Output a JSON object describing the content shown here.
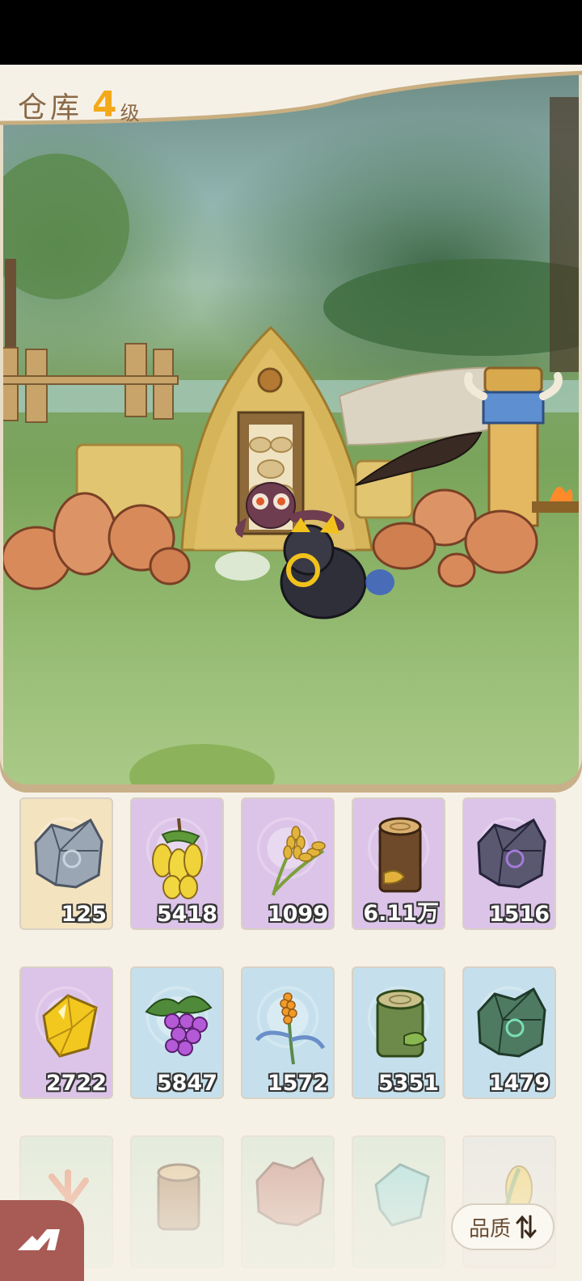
{
  "header": {
    "title": "仓库",
    "level": "4",
    "level_unit": "级"
  },
  "items": [
    {
      "name": "grey-stone",
      "count": "125",
      "quality": "gold"
    },
    {
      "name": "banana",
      "count": "5418",
      "quality": "purple"
    },
    {
      "name": "wheat",
      "count": "1099",
      "quality": "purple"
    },
    {
      "name": "wood-log",
      "count": "6.11万",
      "quality": "purple"
    },
    {
      "name": "dark-stone",
      "count": "1516",
      "quality": "purple"
    },
    {
      "name": "gold-crystal",
      "count": "2722",
      "quality": "purple"
    },
    {
      "name": "grape",
      "count": "5847",
      "quality": "blue"
    },
    {
      "name": "millet",
      "count": "1572",
      "quality": "blue"
    },
    {
      "name": "green-log",
      "count": "5351",
      "quality": "blue"
    },
    {
      "name": "green-stone",
      "count": "1479",
      "quality": "blue"
    },
    {
      "name": "coral-plant",
      "count": "",
      "quality": "green"
    },
    {
      "name": "cut-log",
      "count": "",
      "quality": "green"
    },
    {
      "name": "red-stone",
      "count": "",
      "quality": "green"
    },
    {
      "name": "cyan-crystal",
      "count": "",
      "quality": "green"
    },
    {
      "name": "corn",
      "count": "",
      "quality": "grey"
    }
  ],
  "controls": {
    "sort_label": "品质",
    "back_icon": "back-arrow-icon",
    "sort_icon": "sort-arrows-icon"
  },
  "colors": {
    "gold": "#f4e3bf",
    "purple": "#dcc3e8",
    "blue": "#c5e0ec",
    "green": "#cfe8cf",
    "grey": "#e2e2e2",
    "level": "#f3a91a"
  }
}
